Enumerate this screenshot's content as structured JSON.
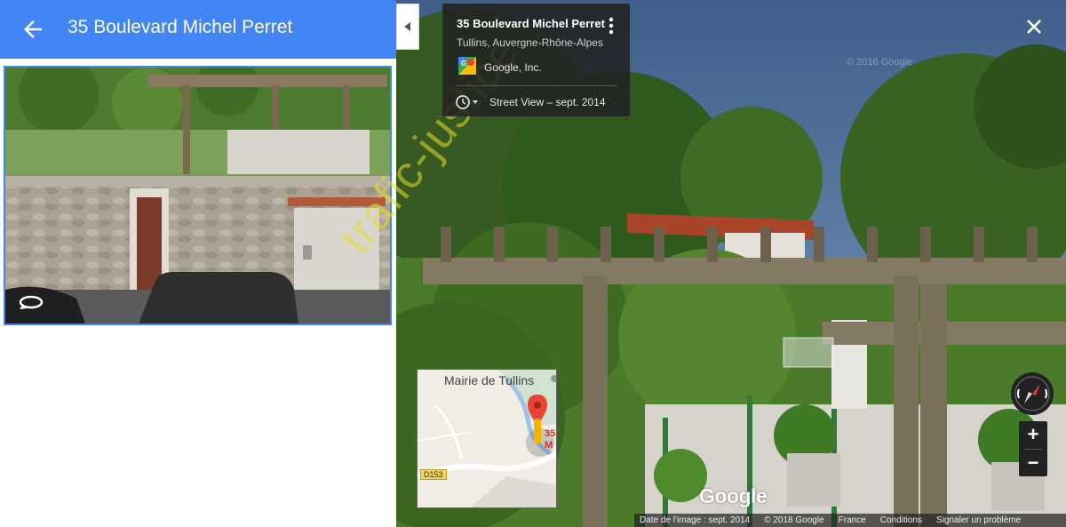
{
  "left_panel": {
    "title": "35 Boulevard Michel Perret"
  },
  "info_card": {
    "title": "35 Boulevard Michel Perret",
    "subtitle": "Tullins, Auvergne-Rhône-Alpes",
    "author": "Google, Inc.",
    "date_label": "Street View – sept. 2014"
  },
  "overlay": {
    "watermark": "trafic-justice",
    "copyright_watermark": "© 2016 Google"
  },
  "minimap": {
    "place_label": "Mairie de Tullins",
    "road_badge": "D153",
    "pin_label_line1": "35",
    "pin_label_line2": "M"
  },
  "controls": {
    "zoom_in": "+",
    "zoom_out": "−"
  },
  "brand": {
    "logo": "Google"
  },
  "footer": {
    "image_date": "Date de l'image : sept. 2014",
    "copyright": "© 2018 Google",
    "country": "France",
    "terms": "Conditions",
    "report": "Signaler un problème"
  },
  "colors": {
    "accent": "#4285f4",
    "card_bg": "#222222",
    "watermark": "#e6dc28"
  },
  "icons": {
    "back": "arrow-left-icon",
    "rotate": "rotate-360-icon",
    "collapse": "triangle-left-icon",
    "menu": "more-vert-icon",
    "author": "google-maps-logo-icon",
    "history": "clock-icon",
    "close": "close-icon",
    "compass": "compass-icon",
    "pin": "map-pin-icon"
  }
}
